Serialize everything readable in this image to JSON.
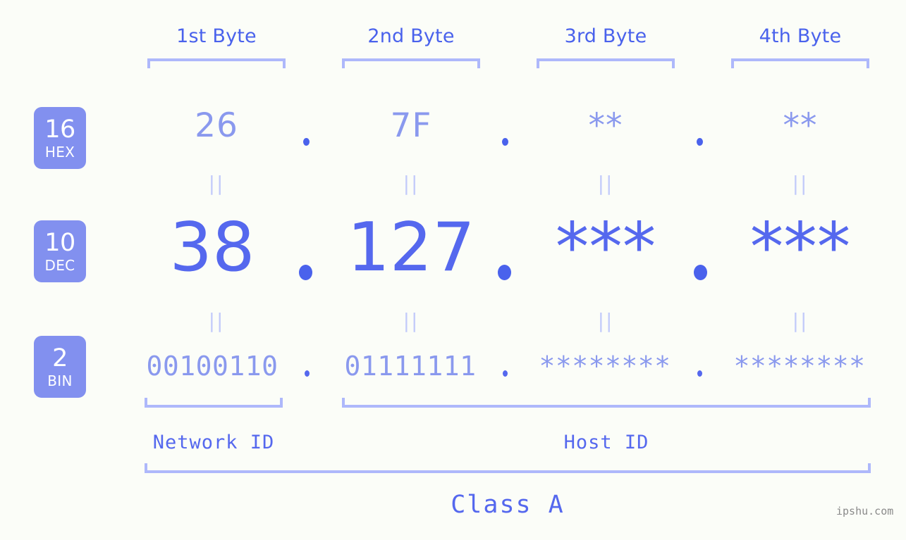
{
  "page": {
    "background_color": "#fbfdf8",
    "accent_color": "#5568ee",
    "badge_color": "#8290ef",
    "bracket_color": "#aeb8fb",
    "muted_color": "#8a99ee"
  },
  "byte_headers": [
    {
      "label": "1st Byte"
    },
    {
      "label": "2nd Byte"
    },
    {
      "label": "3rd Byte"
    },
    {
      "label": "4th Byte"
    }
  ],
  "rows": {
    "hex": {
      "base": "16",
      "name": "HEX",
      "values": [
        "26",
        "7F",
        "**",
        "**"
      ],
      "separator": "."
    },
    "dec": {
      "base": "10",
      "name": "DEC",
      "values": [
        "38",
        "127",
        "***",
        "***"
      ],
      "separator": "."
    },
    "bin": {
      "base": "2",
      "name": "BIN",
      "values": [
        "00100110",
        "01111111",
        "********",
        "********"
      ],
      "separator": "."
    }
  },
  "equals_marks": {
    "glyph": "||",
    "hex_to_dec": [
      "||",
      "||",
      "||",
      "||"
    ],
    "dec_to_bin": [
      "||",
      "||",
      "||",
      "||"
    ]
  },
  "regions": [
    {
      "label": "Network ID"
    },
    {
      "label": "Host ID"
    }
  ],
  "class": {
    "label": "Class A"
  },
  "watermark": {
    "text": "ipshu.com"
  }
}
